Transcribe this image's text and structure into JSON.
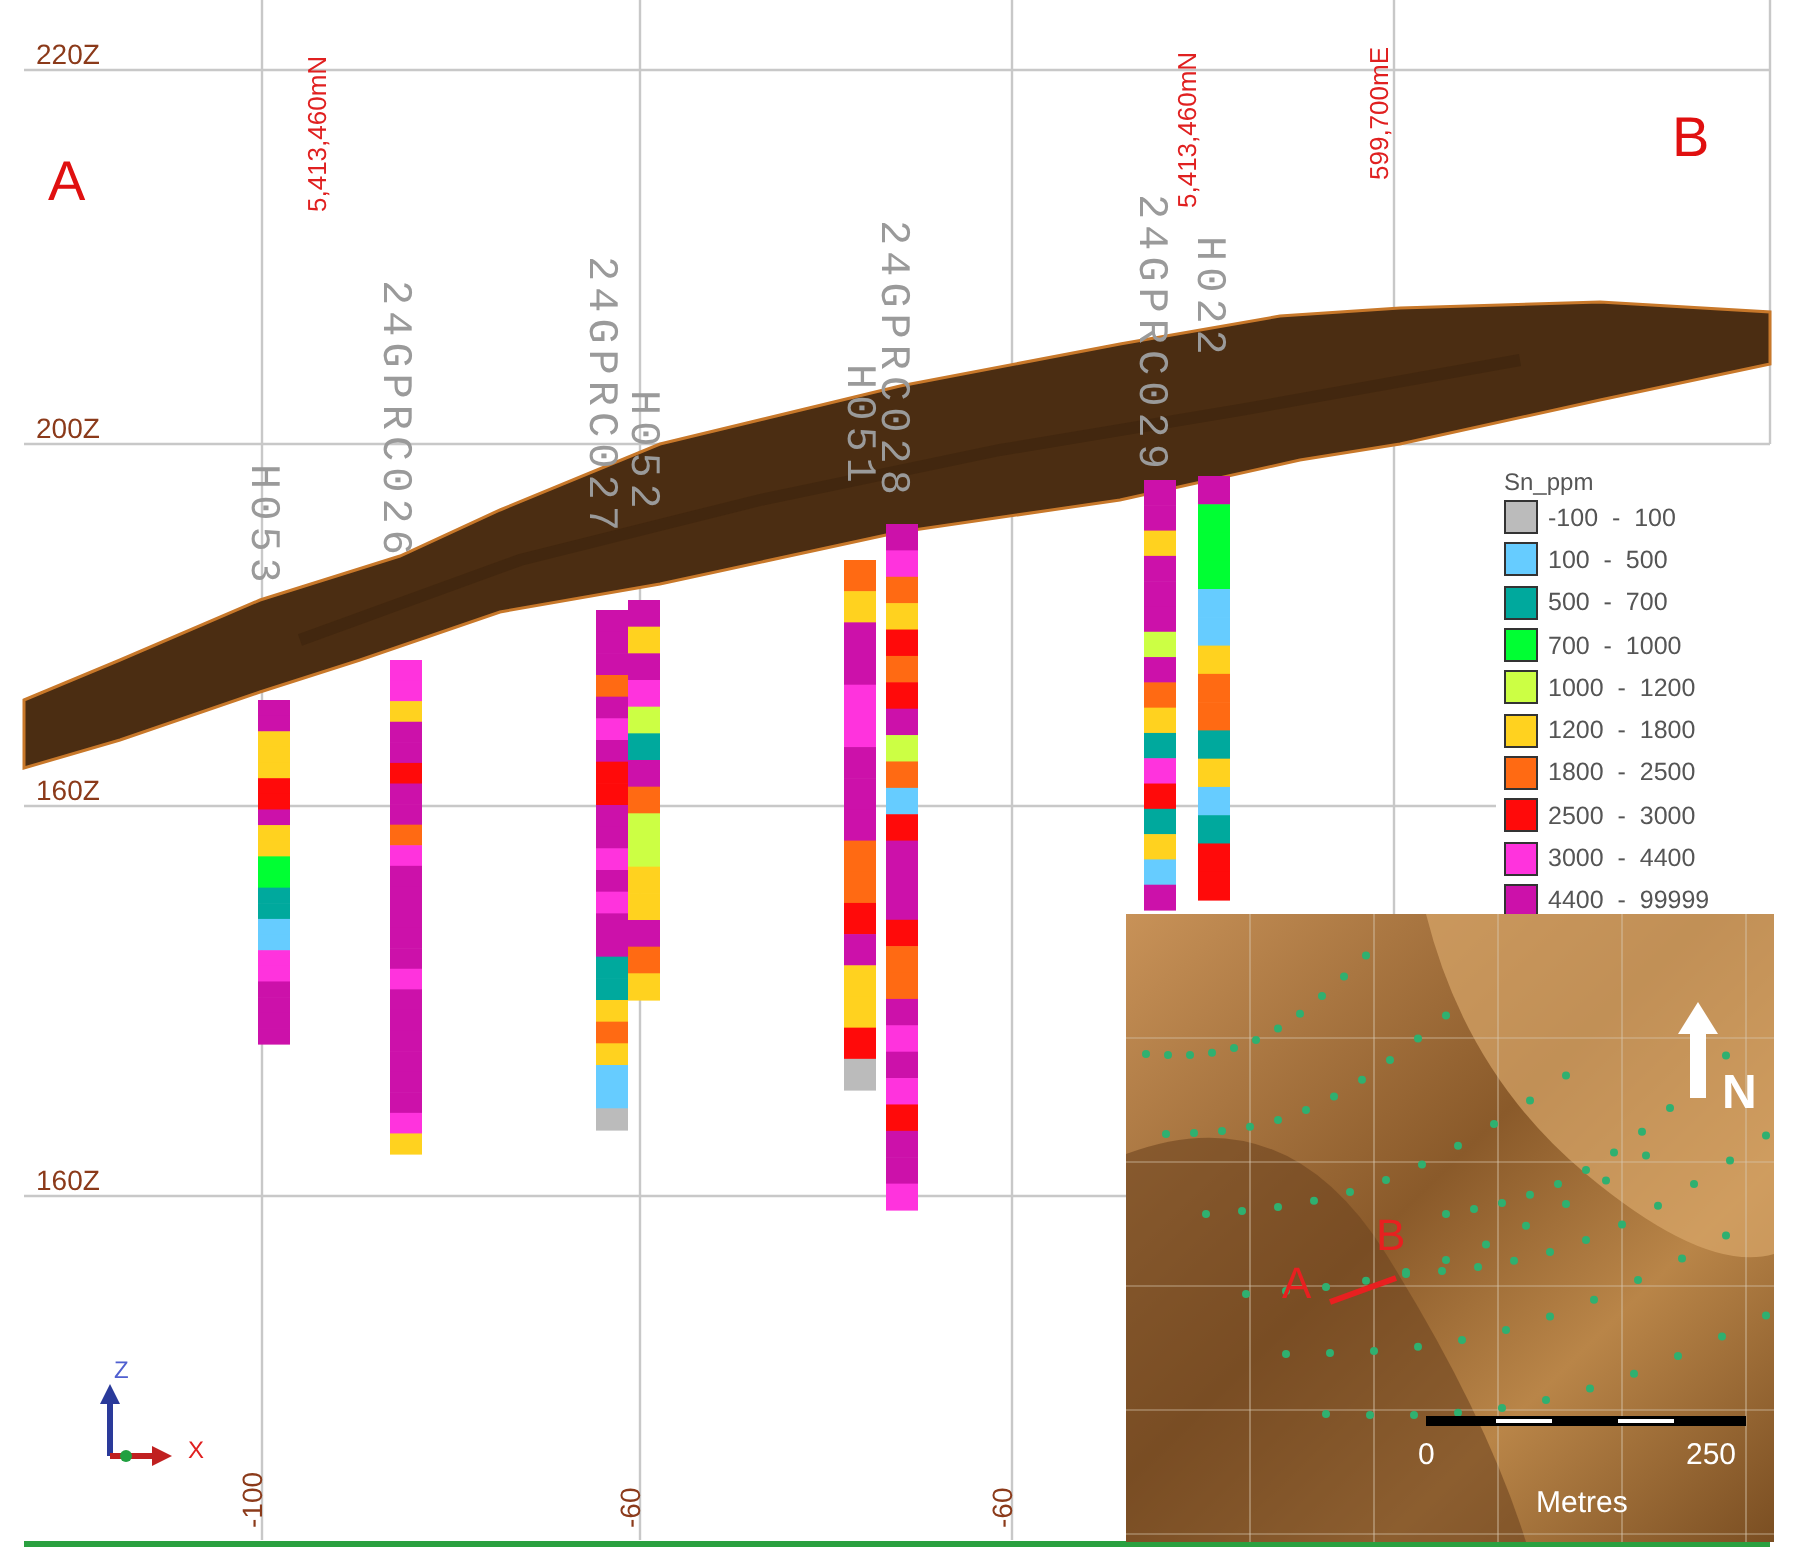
{
  "section": {
    "end_labels": [
      "A",
      "B"
    ],
    "elevation_labels": [
      "220Z",
      "200Z",
      "160Z",
      "160Z"
    ],
    "grid_labels": [
      "5,413,460mN",
      "5,413,460mN",
      "599,700mE"
    ],
    "offset_labels": [
      "-100",
      "-60",
      "-60"
    ]
  },
  "drillholes": [
    {
      "name": "H053",
      "segments": [
        {
          "color": "#cc11aa"
        },
        {
          "color": "#cc11aa"
        },
        {
          "color": "#ffd21f"
        },
        {
          "color": "#ffd21f"
        },
        {
          "color": "#ffd21f"
        },
        {
          "color": "#ff0a0a"
        },
        {
          "color": "#ff0a0a"
        },
        {
          "color": "#cc11aa"
        },
        {
          "color": "#ffd21f"
        },
        {
          "color": "#ffd21f"
        },
        {
          "color": "#00ff33"
        },
        {
          "color": "#00ff33"
        },
        {
          "color": "#00a99d"
        },
        {
          "color": "#00a99d"
        },
        {
          "color": "#66ccff"
        },
        {
          "color": "#66ccff"
        },
        {
          "color": "#ff33dd"
        },
        {
          "color": "#ff33dd"
        },
        {
          "color": "#cc11aa"
        },
        {
          "color": "#cc11aa"
        },
        {
          "color": "#cc11aa"
        },
        {
          "color": "#cc11aa"
        }
      ]
    },
    {
      "name": "24GPRC026",
      "segments": [
        {
          "color": "#ff33dd"
        },
        {
          "color": "#ff33dd"
        },
        {
          "color": "#ffd21f"
        },
        {
          "color": "#cc11aa"
        },
        {
          "color": "#cc11aa"
        },
        {
          "color": "#ff0a0a"
        },
        {
          "color": "#cc11aa"
        },
        {
          "color": "#cc11aa"
        },
        {
          "color": "#ff6a13"
        },
        {
          "color": "#ff33dd"
        },
        {
          "color": "#cc11aa"
        },
        {
          "color": "#cc11aa"
        },
        {
          "color": "#cc11aa"
        },
        {
          "color": "#cc11aa"
        },
        {
          "color": "#cc11aa"
        },
        {
          "color": "#ff33dd"
        },
        {
          "color": "#cc11aa"
        },
        {
          "color": "#cc11aa"
        },
        {
          "color": "#cc11aa"
        },
        {
          "color": "#cc11aa"
        },
        {
          "color": "#cc11aa"
        },
        {
          "color": "#cc11aa"
        },
        {
          "color": "#ff33dd"
        },
        {
          "color": "#ffd21f"
        }
      ]
    },
    {
      "name": "24GPRC027",
      "segments": [
        {
          "color": "#cc11aa"
        },
        {
          "color": "#cc11aa"
        },
        {
          "color": "#cc11aa"
        },
        {
          "color": "#ff6a13"
        },
        {
          "color": "#cc11aa"
        },
        {
          "color": "#ff33dd"
        },
        {
          "color": "#cc11aa"
        },
        {
          "color": "#ff0a0a"
        },
        {
          "color": "#ff0a0a"
        },
        {
          "color": "#cc11aa"
        },
        {
          "color": "#cc11aa"
        },
        {
          "color": "#ff33dd"
        },
        {
          "color": "#cc11aa"
        },
        {
          "color": "#ff33dd"
        },
        {
          "color": "#cc11aa"
        },
        {
          "color": "#cc11aa"
        },
        {
          "color": "#00a99d"
        },
        {
          "color": "#00a99d"
        },
        {
          "color": "#ffd21f"
        },
        {
          "color": "#ff6a13"
        },
        {
          "color": "#ffd21f"
        },
        {
          "color": "#66ccff"
        },
        {
          "color": "#66ccff"
        },
        {
          "color": "#bbbbbb"
        }
      ]
    },
    {
      "name": "H052",
      "segments": [
        {
          "color": "#cc11aa"
        },
        {
          "color": "#ffd21f"
        },
        {
          "color": "#cc11aa"
        },
        {
          "color": "#ff33dd"
        },
        {
          "color": "#ccff44"
        },
        {
          "color": "#00a99d"
        },
        {
          "color": "#cc11aa"
        },
        {
          "color": "#ff6a13"
        },
        {
          "color": "#ccff44"
        },
        {
          "color": "#ccff44"
        },
        {
          "color": "#ffd21f"
        },
        {
          "color": "#ffd21f"
        },
        {
          "color": "#cc11aa"
        },
        {
          "color": "#ff6a13"
        },
        {
          "color": "#ffd21f"
        }
      ]
    },
    {
      "name": "H051",
      "segments": [
        {
          "color": "#ff6a13"
        },
        {
          "color": "#ffd21f"
        },
        {
          "color": "#cc11aa"
        },
        {
          "color": "#cc11aa"
        },
        {
          "color": "#ff33dd"
        },
        {
          "color": "#ff33dd"
        },
        {
          "color": "#cc11aa"
        },
        {
          "color": "#cc11aa"
        },
        {
          "color": "#cc11aa"
        },
        {
          "color": "#ff6a13"
        },
        {
          "color": "#ff6a13"
        },
        {
          "color": "#ff0a0a"
        },
        {
          "color": "#cc11aa"
        },
        {
          "color": "#ffd21f"
        },
        {
          "color": "#ffd21f"
        },
        {
          "color": "#ff0a0a"
        },
        {
          "color": "#bbbbbb"
        }
      ]
    },
    {
      "name": "24GPRC028",
      "segments": [
        {
          "color": "#cc11aa"
        },
        {
          "color": "#ff33dd"
        },
        {
          "color": "#ff6a13"
        },
        {
          "color": "#ffd21f"
        },
        {
          "color": "#ff0a0a"
        },
        {
          "color": "#ff6a13"
        },
        {
          "color": "#ff0a0a"
        },
        {
          "color": "#cc11aa"
        },
        {
          "color": "#ccff44"
        },
        {
          "color": "#ff6a13"
        },
        {
          "color": "#66ccff"
        },
        {
          "color": "#ff0a0a"
        },
        {
          "color": "#cc11aa"
        },
        {
          "color": "#cc11aa"
        },
        {
          "color": "#cc11aa"
        },
        {
          "color": "#ff0a0a"
        },
        {
          "color": "#ff6a13"
        },
        {
          "color": "#ff6a13"
        },
        {
          "color": "#cc11aa"
        },
        {
          "color": "#ff33dd"
        },
        {
          "color": "#cc11aa"
        },
        {
          "color": "#ff33dd"
        },
        {
          "color": "#ff0a0a"
        },
        {
          "color": "#cc11aa"
        },
        {
          "color": "#cc11aa"
        },
        {
          "color": "#ff33dd"
        }
      ]
    },
    {
      "name": "24GPRC029",
      "segments": [
        {
          "color": "#cc11aa"
        },
        {
          "color": "#cc11aa"
        },
        {
          "color": "#ffd21f"
        },
        {
          "color": "#cc11aa"
        },
        {
          "color": "#cc11aa"
        },
        {
          "color": "#cc11aa"
        },
        {
          "color": "#ccff44"
        },
        {
          "color": "#cc11aa"
        },
        {
          "color": "#ff6a13"
        },
        {
          "color": "#ffd21f"
        },
        {
          "color": "#00a99d"
        },
        {
          "color": "#ff33dd"
        },
        {
          "color": "#ff0a0a"
        },
        {
          "color": "#00a99d"
        },
        {
          "color": "#ffd21f"
        },
        {
          "color": "#66ccff"
        },
        {
          "color": "#cc11aa"
        }
      ]
    },
    {
      "name": "H022",
      "segments": [
        {
          "color": "#cc11aa"
        },
        {
          "color": "#00ff33"
        },
        {
          "color": "#00ff33"
        },
        {
          "color": "#00ff33"
        },
        {
          "color": "#66ccff"
        },
        {
          "color": "#66ccff"
        },
        {
          "color": "#ffd21f"
        },
        {
          "color": "#ff6a13"
        },
        {
          "color": "#ff6a13"
        },
        {
          "color": "#00a99d"
        },
        {
          "color": "#ffd21f"
        },
        {
          "color": "#66ccff"
        },
        {
          "color": "#00a99d"
        },
        {
          "color": "#ff0a0a"
        },
        {
          "color": "#ff0a0a"
        }
      ]
    }
  ],
  "legend": {
    "title": "Sn_ppm",
    "items": [
      {
        "range": "-100  -  100",
        "color": "#bbbbbb"
      },
      {
        "range": "100  -  500",
        "color": "#66ccff"
      },
      {
        "range": "500  -  700",
        "color": "#00a99d"
      },
      {
        "range": "700  -  1000",
        "color": "#00ff33"
      },
      {
        "range": "1000  -  1200",
        "color": "#ccff44"
      },
      {
        "range": "1200  -  1800",
        "color": "#ffd21f"
      },
      {
        "range": "1800  -  2500",
        "color": "#ff6a13"
      },
      {
        "range": "2500  -  3000",
        "color": "#ff0a0a"
      },
      {
        "range": "3000  -  4400",
        "color": "#ff33dd"
      },
      {
        "range": "4400  -  99999",
        "color": "#cc11aa"
      }
    ]
  },
  "inset_map": {
    "section_labels": [
      "A",
      "B"
    ],
    "north_label": "N",
    "scale": {
      "start": "0",
      "end": "250",
      "unit": "Metres"
    }
  },
  "axis_triad": {
    "labels": [
      "Z",
      "X"
    ]
  }
}
